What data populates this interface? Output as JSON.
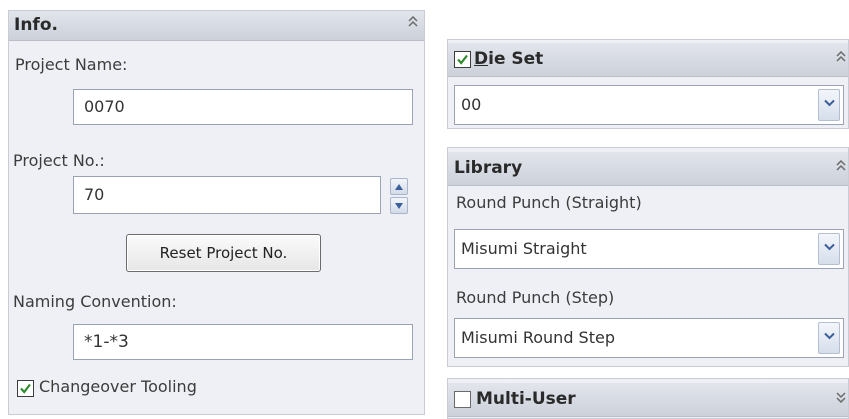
{
  "info_panel": {
    "title": "Info.",
    "project_name_label": "Project Name:",
    "project_name_value": "0070",
    "project_no_label": "Project No.:",
    "project_no_value": "70",
    "reset_button_label": "Reset Project No.",
    "naming_convention_label": "Naming Convention:",
    "naming_convention_value": "*1-*3",
    "changeover_label": "Changeover Tooling",
    "changeover_checked": true
  },
  "die_set_panel": {
    "title_underlined": "D",
    "title_rest": "ie Set",
    "checked": true,
    "select_value": "00"
  },
  "library_panel": {
    "title": "Library",
    "straight_label": "Round Punch (Straight)",
    "straight_value": "Misumi Straight",
    "step_label": "Round Punch (Step)",
    "step_value": "Misumi Round Step"
  },
  "multi_user_panel": {
    "title": "Multi-User",
    "checked": false
  },
  "icons": {
    "collapse": "double-chevron-up-icon",
    "expand": "double-chevron-down-icon",
    "dropdown": "chevron-down-icon",
    "spin_up": "triangle-up-icon",
    "spin_down": "triangle-down-icon",
    "check": "check-icon"
  },
  "colors": {
    "panel_bg": "#eef0f5",
    "header_bg": "#d5d9e1",
    "check_green": "#2e8b2e",
    "arrow_blue": "#3a5f9a"
  }
}
